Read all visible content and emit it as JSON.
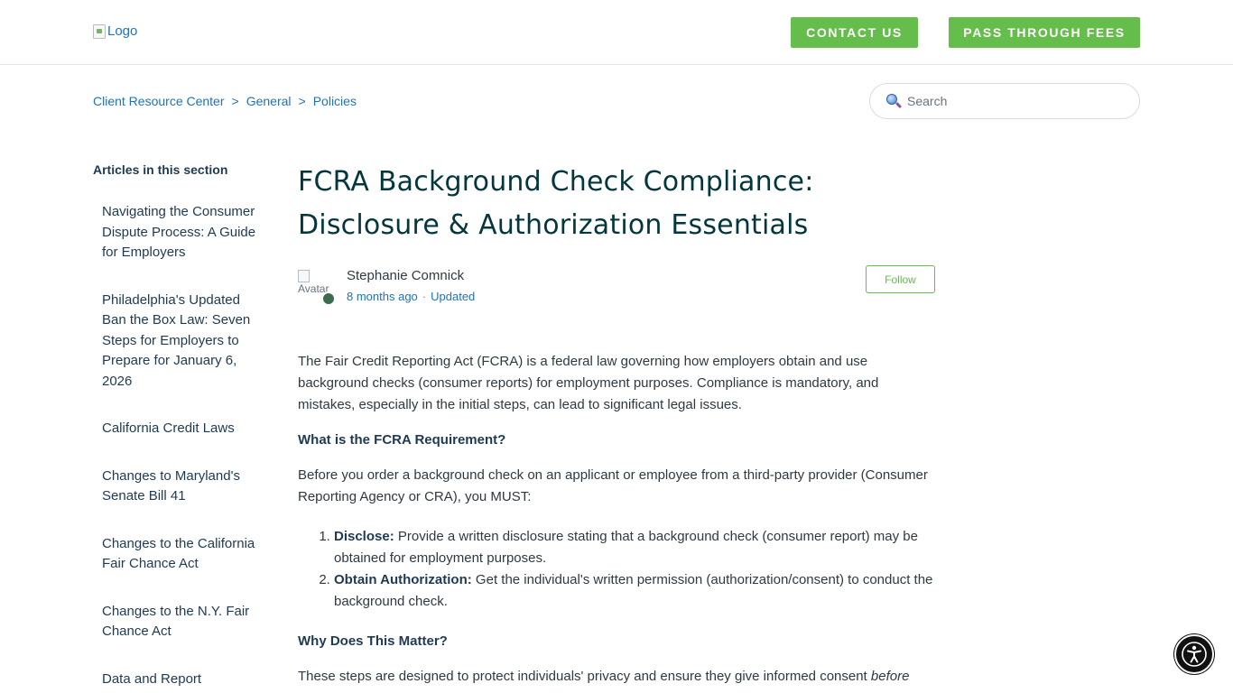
{
  "header": {
    "logo_alt": "Logo",
    "contact_label": "CONTACT US",
    "fees_label": "PASS THROUGH FEES",
    "button_color": "#65bd4c"
  },
  "breadcrumbs": [
    "Client Resource Center",
    "General",
    "Policies"
  ],
  "breadcrumb_separator": ">",
  "search": {
    "placeholder": "Search",
    "icon": "search-icon"
  },
  "sidebar": {
    "title": "Articles in this section",
    "items": [
      "Navigating the Consumer Dispute Process: A Guide for Employers",
      "Philadelphia's Updated Ban the Box Law: Seven Steps for Employers to Prepare for January 6, 2026",
      "California Credit Laws",
      "Changes to Maryland's Senate Bill 41",
      "Changes to the California Fair Chance Act",
      "Changes to the N.Y. Fair Chance Act",
      "Data and Report"
    ]
  },
  "article": {
    "title": "FCRA Background Check Compliance: Disclosure & Authorization Essentials",
    "author": "Stephanie Comnick",
    "avatar_alt": "Avatar",
    "time_ago": "8 months ago",
    "updated_label": "Updated",
    "follow_label": "Follow",
    "intro": "The Fair Credit Reporting Act (FCRA) is a federal law governing how employers obtain and use background checks (consumer reports) for employment purposes. Compliance is mandatory, and mistakes, especially in the initial steps, can lead to significant legal issues.",
    "heading1": "What is the FCRA Requirement?",
    "para2": "Before you order a background check on an applicant or employee from a third-party provider (Consumer Reporting Agency or CRA), you MUST:",
    "steps": [
      {
        "term": "Disclose:",
        "text": " Provide a written disclosure stating that a background check (consumer report) may be obtained for employment purposes."
      },
      {
        "term": "Obtain Authorization:",
        "text": " Get the individual's written permission (authorization/consent) to conduct the background check."
      }
    ],
    "heading2": "Why Does This Matter?",
    "para3": "These steps are designed to protect individuals' privacy and ensure they give informed consent ",
    "para3_em": "before"
  },
  "accessibility_button": {
    "icon": "accessibility-icon"
  }
}
